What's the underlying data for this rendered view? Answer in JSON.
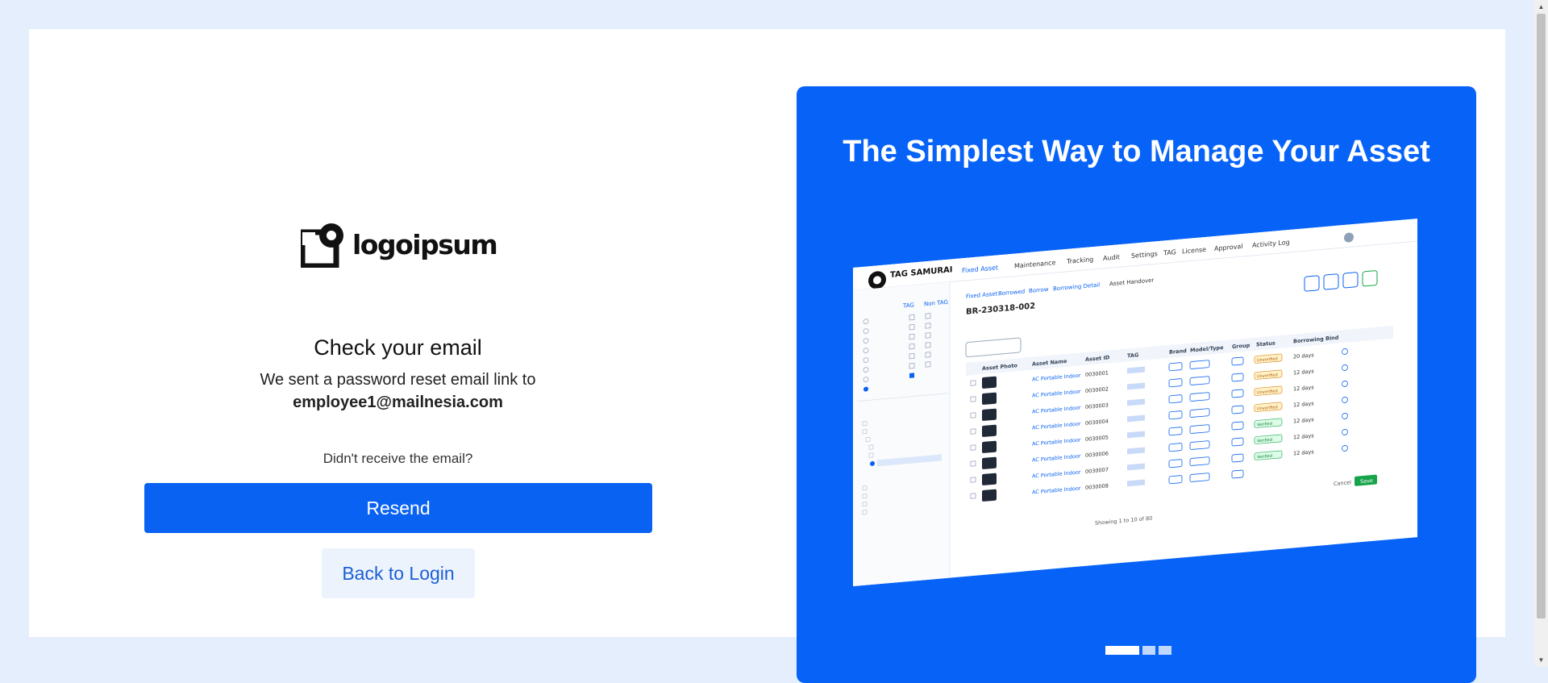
{
  "auth": {
    "logo_text": "logoipsum",
    "title": "Check your email",
    "message": "We sent a password reset email link to",
    "email": "employee1@mailnesia.com",
    "no_receive_text": "Didn't receive the email?",
    "resend_label": "Resend",
    "back_label": "Back to Login"
  },
  "promo": {
    "headline": "The Simplest Way to Manage Your Asset",
    "carousel": {
      "count": 3,
      "active": 1
    }
  },
  "preview": {
    "brand": "TAG SAMURAI",
    "nav": [
      "Fixed Asset",
      "Maintenance",
      "Tracking",
      "Audit",
      "Settings",
      "TAG",
      "License",
      "Approval",
      "Activity Log"
    ],
    "breadcrumb": [
      "Fixed Asset",
      "Borrowed",
      "Borrow",
      "Borrowing Detail",
      "Asset Handover"
    ],
    "record_id": "BR-230318-002",
    "side_tabs": [
      "TAG",
      "Non TAG"
    ],
    "columns": [
      "Asset Photo",
      "Asset Name",
      "Asset ID",
      "TAG",
      "Brand",
      "Model/Type",
      "Group",
      "Status",
      "Borrowing Bind"
    ],
    "rows": [
      {
        "name": "AC Portable Indoor",
        "id": "0030001",
        "status": "Unverified",
        "bind": "20 days"
      },
      {
        "name": "AC Portable Indoor",
        "id": "0030002",
        "status": "Unverified",
        "bind": "12 days"
      },
      {
        "name": "AC Portable Indoor",
        "id": "0030003",
        "status": "Unverified",
        "bind": "12 days"
      },
      {
        "name": "AC Portable Indoor",
        "id": "0030004",
        "status": "Unverified",
        "bind": "12 days"
      },
      {
        "name": "AC Portable Indoor",
        "id": "0030005",
        "status": "Verified",
        "bind": "12 days"
      },
      {
        "name": "AC Portable Indoor",
        "id": "0030006",
        "status": "Verified",
        "bind": "12 days"
      },
      {
        "name": "AC Portable Indoor",
        "id": "0030007",
        "status": "Verified",
        "bind": "12 days"
      },
      {
        "name": "AC Portable Indoor",
        "id": "0030008",
        "status": "",
        "bind": ""
      }
    ],
    "footer": "Showing 1 to 10 of 80",
    "actions": [
      "Cancel",
      "Save"
    ]
  },
  "colors": {
    "primary": "#0a62f3",
    "promo_bg": "#0763f7",
    "page_bg": "#e4eefc",
    "secondary_bg": "#edf3fd",
    "secondary_text": "#1a5fd6"
  }
}
